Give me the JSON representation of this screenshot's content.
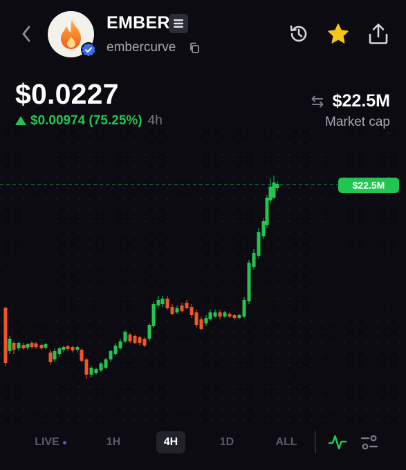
{
  "header": {
    "token_name": "EMBER",
    "token_handle": "embercurve",
    "icons": {
      "back": "chevron-left-icon",
      "menu": "menu-lines-icon",
      "copy": "copy-icon",
      "history": "history-icon",
      "favorite": "star-icon",
      "share": "share-icon",
      "verified": "verified-badge-icon"
    }
  },
  "price": {
    "value": "$0.0227",
    "change": "$0.00974 (75.25%)",
    "period": "4h",
    "direction": "up"
  },
  "market_cap": {
    "value": "$22.5M",
    "label": "Market cap"
  },
  "chart": {
    "price_tag": "$22.5M"
  },
  "timeframes": {
    "items": [
      {
        "label": "LIVE",
        "active": false
      },
      {
        "label": "1H",
        "active": false
      },
      {
        "label": "4H",
        "active": true
      },
      {
        "label": "1D",
        "active": false
      },
      {
        "label": "ALL",
        "active": false
      }
    ]
  },
  "colors": {
    "background": "#0b0b11",
    "up": "#23c552",
    "down": "#f0562a",
    "favorite": "#f5c518",
    "muted": "#a7a7b4",
    "verified": "#3d6ee8"
  }
}
